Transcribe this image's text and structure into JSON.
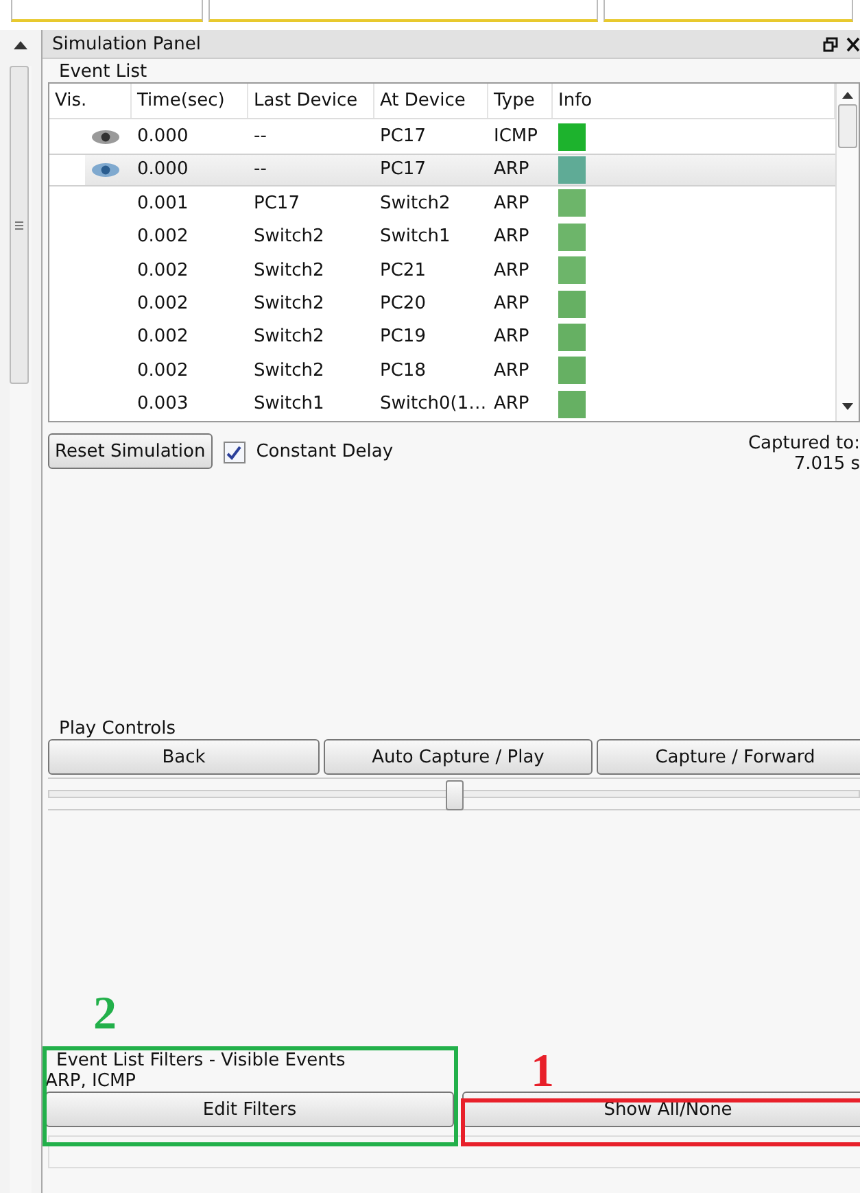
{
  "panel": {
    "title": "Simulation Panel"
  },
  "event_list": {
    "label": "Event List",
    "columns": [
      "Vis.",
      "Time(sec)",
      "Last Device",
      "At Device",
      "Type",
      "Info"
    ],
    "rows": [
      {
        "visible": true,
        "selected": false,
        "time": "0.000",
        "last_device": "--",
        "at_device": "PC17",
        "type": "ICMP",
        "color": "#1db32d"
      },
      {
        "visible": true,
        "selected": true,
        "time": "0.000",
        "last_device": "--",
        "at_device": "PC17",
        "type": "ARP",
        "color": "#5fab96"
      },
      {
        "visible": false,
        "selected": false,
        "time": "0.001",
        "last_device": "PC17",
        "at_device": "Switch2",
        "type": "ARP",
        "color": "#6db56a"
      },
      {
        "visible": false,
        "selected": false,
        "time": "0.002",
        "last_device": "Switch2",
        "at_device": "Switch1",
        "type": "ARP",
        "color": "#6db56a"
      },
      {
        "visible": false,
        "selected": false,
        "time": "0.002",
        "last_device": "Switch2",
        "at_device": "PC21",
        "type": "ARP",
        "color": "#6db56a"
      },
      {
        "visible": false,
        "selected": false,
        "time": "0.002",
        "last_device": "Switch2",
        "at_device": "PC20",
        "type": "ARP",
        "color": "#66b063"
      },
      {
        "visible": false,
        "selected": false,
        "time": "0.002",
        "last_device": "Switch2",
        "at_device": "PC19",
        "type": "ARP",
        "color": "#66b063"
      },
      {
        "visible": false,
        "selected": false,
        "time": "0.002",
        "last_device": "Switch2",
        "at_device": "PC18",
        "type": "ARP",
        "color": "#66b063"
      },
      {
        "visible": false,
        "selected": false,
        "time": "0.003",
        "last_device": "Switch1",
        "at_device": "Switch0(1…",
        "type": "ARP",
        "color": "#66b063"
      }
    ]
  },
  "reset_button": "Reset Simulation",
  "constant_delay": {
    "label": "Constant Delay",
    "checked": true
  },
  "captured": {
    "label": "Captured to:",
    "value": "7.015 s"
  },
  "play_controls": {
    "label": "Play Controls",
    "buttons": [
      "Back",
      "Auto Capture / Play",
      "Capture / Forward"
    ],
    "level": 0.5
  },
  "filters": {
    "label": "Event List Filters - Visible Events",
    "value": "ARP, ICMP",
    "buttons": [
      "Edit Filters",
      "Show All/None"
    ]
  },
  "annotations": [
    {
      "text": "2",
      "color": "#22b04a"
    },
    {
      "text": "1",
      "color": "#e8202a"
    }
  ]
}
